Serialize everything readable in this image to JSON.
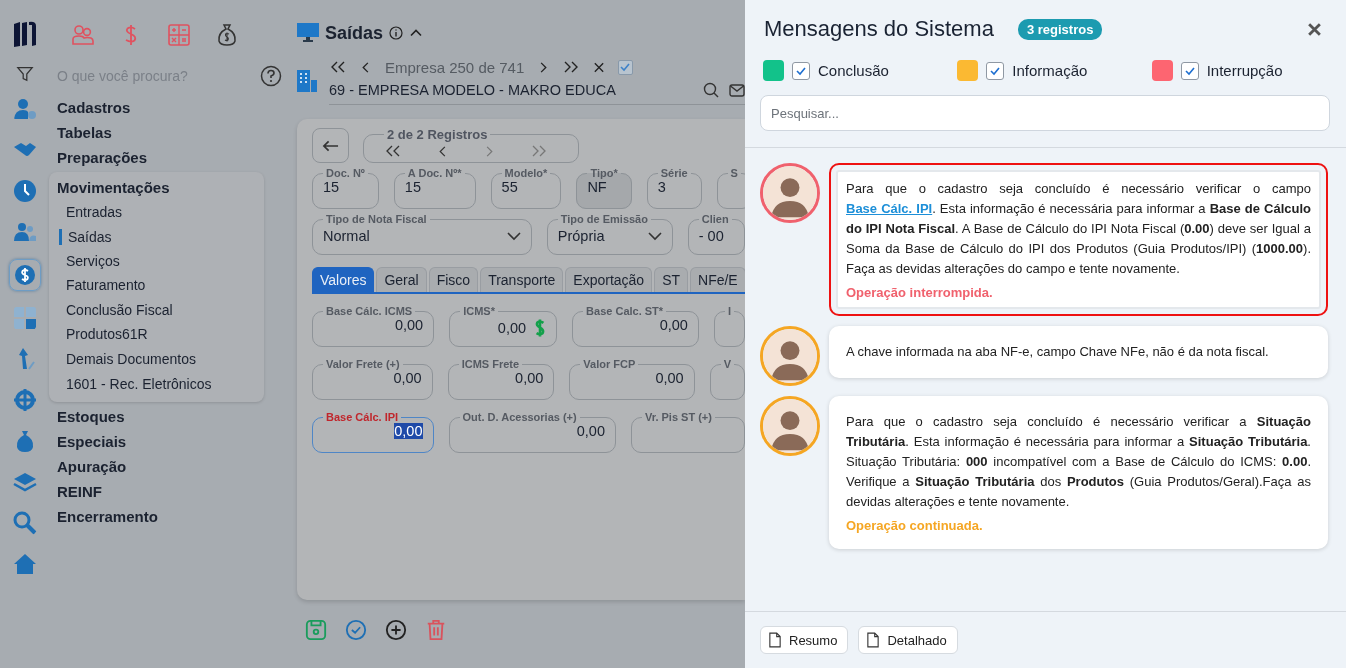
{
  "sidebar": {
    "search": {
      "placeholder": "O que você procura?"
    },
    "rail": [
      {
        "selected": false
      },
      {
        "selected": false
      },
      {
        "selected": false
      },
      {
        "selected": false
      },
      {
        "selected": true
      },
      {
        "selected": false
      },
      {
        "selected": false
      },
      {
        "selected": false
      },
      {
        "selected": false
      },
      {
        "selected": false
      },
      {
        "selected": false
      },
      {
        "selected": false
      }
    ],
    "menu": [
      {
        "label": "Cadastros",
        "expanded": false
      },
      {
        "label": "Tabelas",
        "expanded": false
      },
      {
        "label": "Preparações",
        "expanded": false
      },
      {
        "label": "Movimentações",
        "expanded": true,
        "children": [
          {
            "label": "Entradas",
            "selected": false
          },
          {
            "label": "Saídas",
            "selected": true
          },
          {
            "label": "Serviços",
            "selected": false
          },
          {
            "label": "Faturamento",
            "selected": false
          },
          {
            "label": "Conclusão Fiscal",
            "selected": false
          },
          {
            "label": "Produtos61R",
            "selected": false
          },
          {
            "label": "Demais Documentos",
            "selected": false
          },
          {
            "label": "1601 - Rec. Eletrônicos",
            "selected": false
          }
        ]
      },
      {
        "label": "Estoques",
        "expanded": false
      },
      {
        "label": "Especiais",
        "expanded": false
      },
      {
        "label": "Apuração",
        "expanded": false
      },
      {
        "label": "REINF",
        "expanded": false
      },
      {
        "label": "Encerramento",
        "expanded": false
      }
    ]
  },
  "page": {
    "title": "Saídas",
    "company": {
      "pager": "Empresa 250 de 741",
      "checked": true,
      "name": "69 - EMPRESA MODELO - MAKRO EDUCA"
    },
    "records": "2 de 2 Registros",
    "fields": [
      {
        "label": "Doc. Nº",
        "value": "15",
        "disabled": false
      },
      {
        "label": "A Doc. Nº*",
        "value": "15",
        "disabled": false
      },
      {
        "label": "Modelo*",
        "value": "55",
        "disabled": false
      },
      {
        "label": "Tipo*",
        "value": "NF",
        "disabled": true
      },
      {
        "label": "Série",
        "value": "3",
        "disabled": false
      },
      {
        "label": "S",
        "disabled": false
      }
    ],
    "selects": [
      {
        "label": "Tipo de Nota Fiscal",
        "value": "Normal"
      },
      {
        "label": "Tipo de Emissão",
        "value": "Própria"
      },
      {
        "label": "Clien",
        "value": "- 00"
      }
    ],
    "tabs": [
      {
        "label": "Valores",
        "selected": true
      },
      {
        "label": "Geral",
        "selected": false
      },
      {
        "label": "Fisco",
        "selected": false
      },
      {
        "label": "Transporte",
        "selected": false
      },
      {
        "label": "Exportação",
        "selected": false
      },
      {
        "label": "ST",
        "selected": false
      },
      {
        "label": "NFe/E",
        "selected": false
      }
    ],
    "values": [
      [
        {
          "label": "Base Cálc. ICMS",
          "value": "0,00",
          "error": false,
          "focused": false
        },
        {
          "label": "ICMS*",
          "value": "0,00",
          "error": false,
          "focused": false
        },
        {
          "label": "Base Calc. ST*",
          "value": "0,00",
          "error": false,
          "focused": false
        },
        {
          "label": "I",
          "error": false,
          "focused": false
        }
      ],
      [
        {
          "label": "Valor Frete (+)",
          "value": "0,00",
          "error": false,
          "focused": false
        },
        {
          "label": "ICMS Frete",
          "value": "0,00",
          "error": false,
          "focused": false
        },
        {
          "label": "Valor FCP",
          "value": "0,00",
          "error": false,
          "focused": false
        },
        {
          "label": "V",
          "error": false,
          "focused": false
        }
      ],
      [
        {
          "label": "Base Cálc. IPI",
          "value": "0,00",
          "error": true,
          "focused": true
        },
        {
          "label": "Out. D. Acessorias (+)",
          "value": "0,00",
          "error": false,
          "focused": false
        },
        {
          "label": "Vr. Pis ST (+)",
          "error": false,
          "focused": false
        }
      ]
    ]
  },
  "messages_panel": {
    "title": "Mensagens do Sistema",
    "count": "3 registros",
    "filters": [
      {
        "label": "Conclusão",
        "color": "#12c28a",
        "checked": true
      },
      {
        "label": "Informação",
        "color": "#fbb932",
        "checked": true
      },
      {
        "label": "Interrupção",
        "color": "#fd6571",
        "checked": true
      }
    ],
    "search": {
      "placeholder": "Pesquisar..."
    },
    "messages": [
      {
        "color": "#f0616d",
        "highlighted": true,
        "parts": [
          {
            "kind": "text",
            "text": "Para que o cadastro seja concluído é necessário verificar o campo "
          },
          {
            "kind": "link",
            "text": "Base Cálc. IPI"
          },
          {
            "kind": "text",
            "text": ". Esta informação é necessária para informar a **Base de Cálculo do IPI Nota Fiscal**. A Base de Cálculo do IPI Nota Fiscal (**0.00**) deve ser Igual a Soma da Base de Cálculo do IPI dos Produtos (Guia Produtos/IPI) (**1000.00**). Faça as devidas alterações do campo e tente novamente."
          }
        ],
        "status": {
          "kind": "interrupted",
          "text": "Operação interrompida."
        }
      },
      {
        "color": "#f5a623",
        "highlighted": false,
        "parts": [
          {
            "kind": "text",
            "text": "A chave informada na aba NF-e, campo Chave NFe, não é da nota fiscal."
          }
        ]
      },
      {
        "color": "#f5a623",
        "highlighted": false,
        "parts": [
          {
            "kind": "text",
            "text": "Para que o cadastro seja concluído é necessário verificar a **Situação Tributária**. Esta informação é necessária para informar a **Situação Tributária**. Situação Tributária: **000** incompatível com a Base de Cálculo do ICMS: **0.00**. Verifique a **Situação Tributária** dos **Produtos** (Guia Produtos/Geral).Faça as devidas alterações e tente novamente."
          }
        ],
        "status": {
          "kind": "continued",
          "text": "Operação continuada."
        }
      }
    ],
    "footer": [
      "Resumo",
      "Detalhado"
    ]
  }
}
